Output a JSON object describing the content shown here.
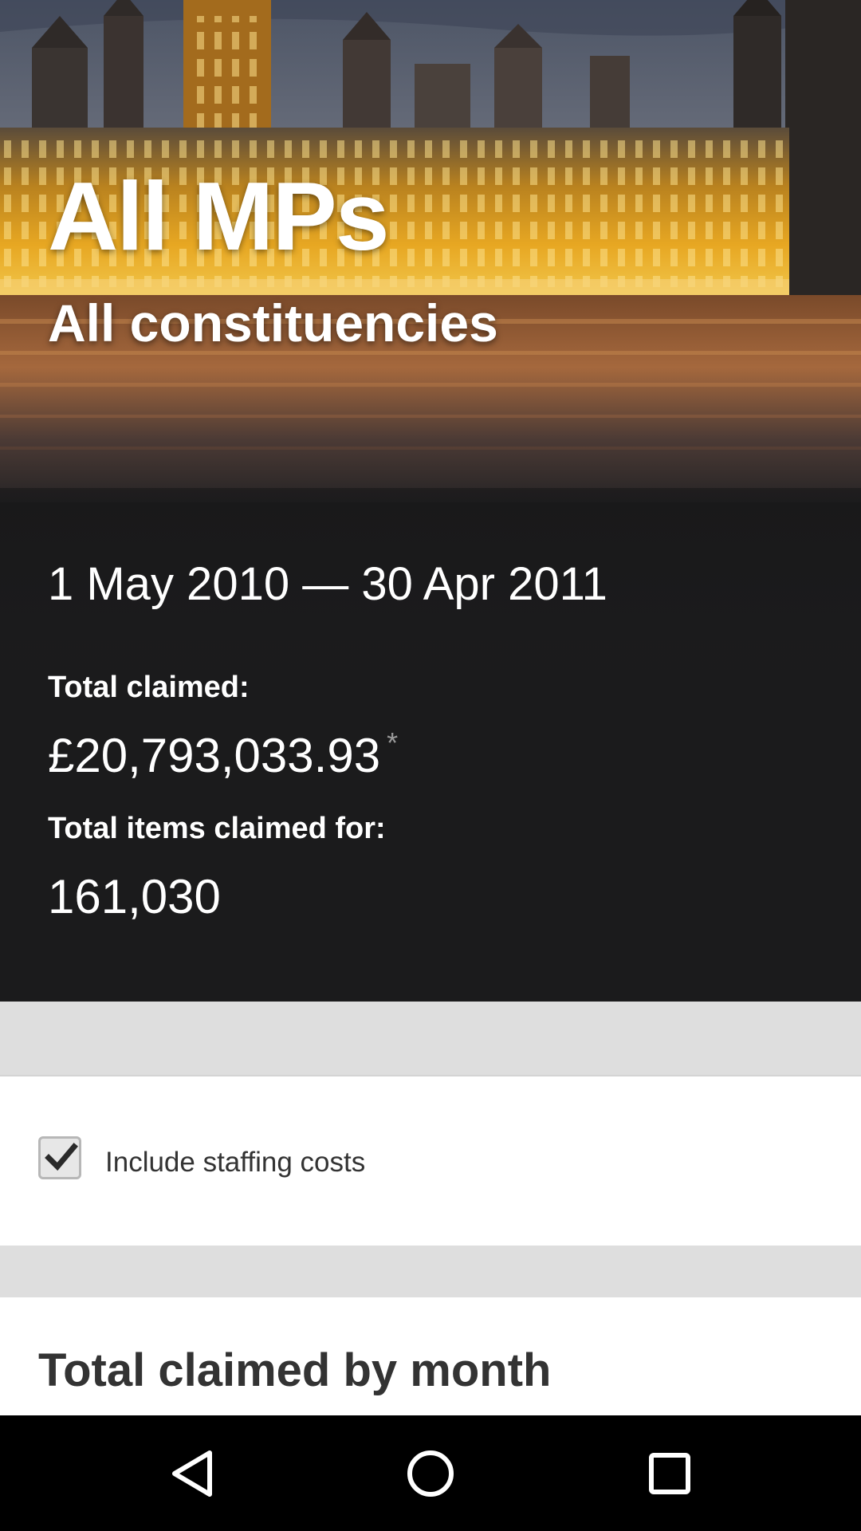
{
  "hero": {
    "title": "All MPs",
    "subtitle": "All constituencies",
    "date_range": "1 May 2010 — 30 Apr 2011",
    "total_claimed_label": "Total claimed:",
    "total_claimed_value": "£20,793,033.93",
    "total_claimed_note": "*",
    "total_items_label": "Total items claimed for:",
    "total_items_value": "161,030"
  },
  "options": {
    "include_staffing_label": "Include staffing costs",
    "include_staffing_checked": true
  },
  "section": {
    "title": "Total claimed by month"
  },
  "navbar": {
    "icons": [
      "back-icon",
      "home-icon",
      "recents-icon"
    ]
  }
}
